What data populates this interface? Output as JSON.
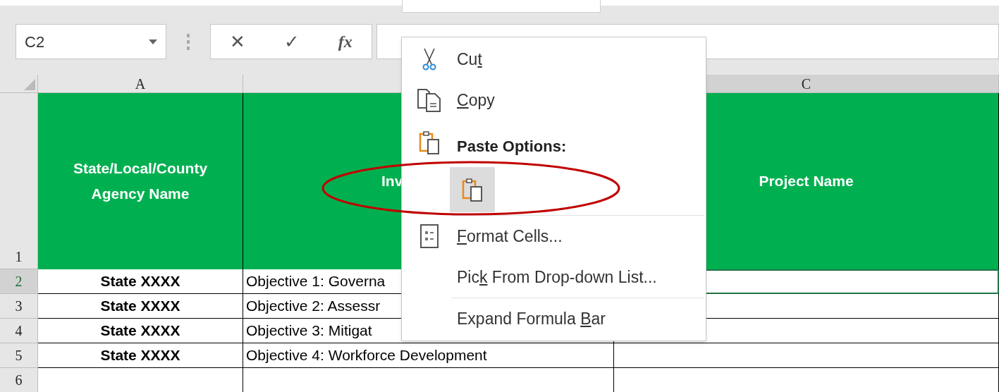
{
  "formula_bar": {
    "name_box": "C2",
    "cancel": "✕",
    "enter": "✓",
    "function": "fx"
  },
  "sheet": {
    "columns": [
      {
        "label": "A",
        "selected": false
      },
      {
        "selected": false
      },
      {
        "label": "C",
        "selected": true
      }
    ],
    "rows": [
      {
        "number": "1",
        "selected": false,
        "cells": [
          {
            "text": "State/Local/County Agency Name",
            "selected": false
          },
          {
            "text": "Inv",
            "selected": false
          },
          {
            "text": "Project Name",
            "selected": false
          }
        ]
      },
      {
        "number": "2",
        "selected": true,
        "cells": [
          {
            "text": "State XXXX",
            "selected": false
          },
          {
            "text": "Objective 1: Governa",
            "selected": false
          },
          {
            "selected": true
          }
        ]
      },
      {
        "number": "3",
        "selected": false,
        "cells": [
          {
            "text": "State XXXX",
            "selected": false
          },
          {
            "text": "Objective 2: Assessr",
            "selected": false
          },
          {
            "selected": false
          }
        ]
      },
      {
        "number": "4",
        "selected": false,
        "cells": [
          {
            "text": "State XXXX",
            "selected": false
          },
          {
            "text": "Objective 3: Mitigat",
            "selected": false
          },
          {
            "selected": false
          }
        ]
      },
      {
        "number": "5",
        "selected": false,
        "cells": [
          {
            "text": "State XXXX",
            "selected": false
          },
          {
            "text": "Objective 4: Workforce Development",
            "selected": false
          },
          {
            "selected": false
          }
        ]
      },
      {
        "number": "6",
        "selected": false,
        "cells": [
          {
            "selected": false
          },
          {
            "selected": false
          },
          {
            "selected": false
          }
        ]
      }
    ]
  },
  "context_menu": [
    {
      "kind": "command",
      "before": "Cu",
      "key": "t"
    },
    {
      "kind": "command",
      "key": "C",
      "after": "opy"
    },
    {
      "kind": "heading",
      "label": "Paste Options:"
    },
    {
      "kind": "paste",
      "selected": true
    },
    {
      "kind": "command",
      "key": "F",
      "after": "ormat Cells..."
    },
    {
      "kind": "command",
      "before": "Pic",
      "key": "k",
      "after": " From Drop-down List..."
    },
    {
      "kind": "command",
      "before": "Expand Formula ",
      "key": "B",
      "after": "ar"
    }
  ]
}
